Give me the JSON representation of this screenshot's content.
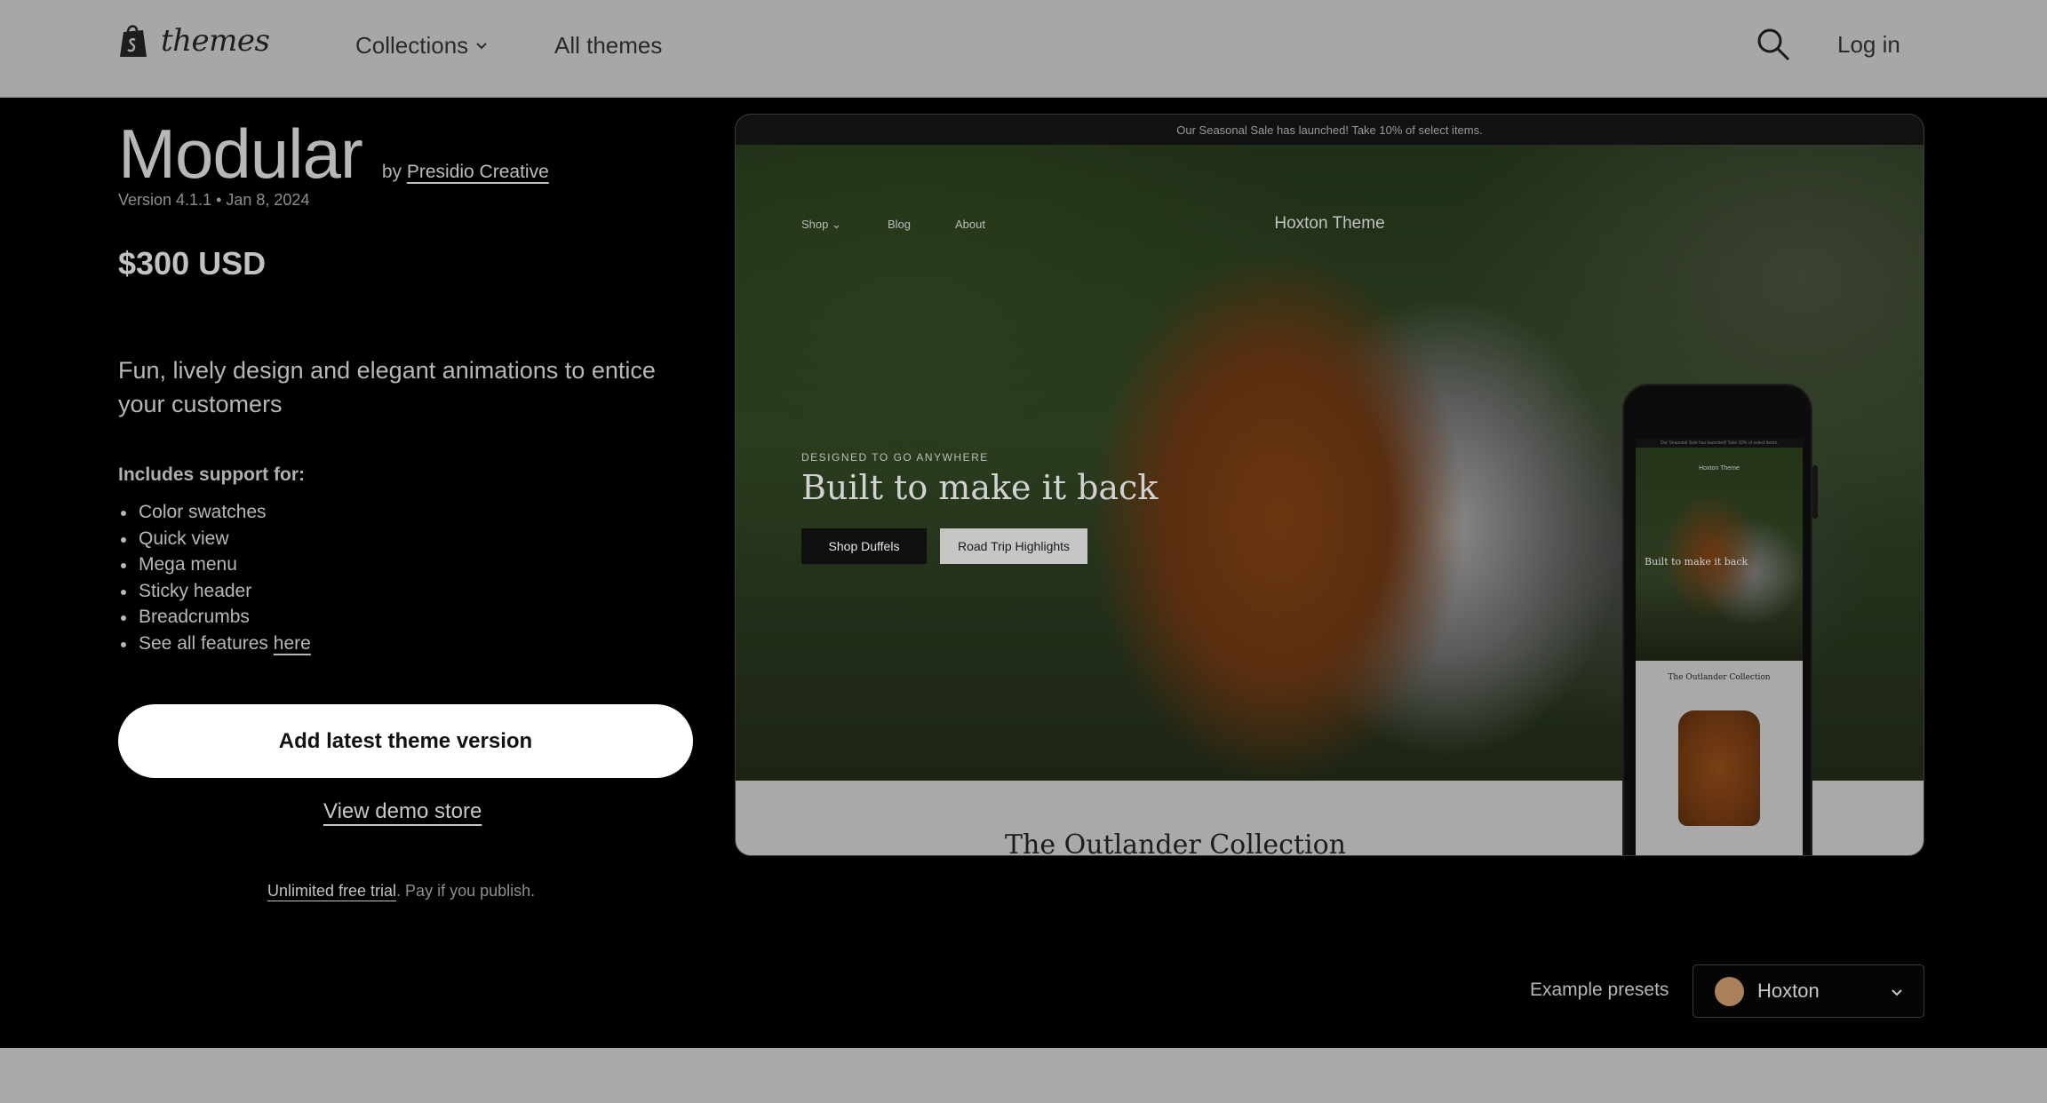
{
  "nav": {
    "logo_text": "themes",
    "collections": "Collections",
    "all_themes": "All themes",
    "login": "Log in"
  },
  "theme": {
    "title": "Modular",
    "by": "by",
    "author": "Presidio Creative",
    "version": "Version 4.1.1 • Jan 8, 2024",
    "price": "$300 USD",
    "description": "Fun, lively design and elegant animations to entice your customers",
    "support_title": "Includes support for:",
    "features": [
      "Color swatches",
      "Quick view",
      "Mega menu",
      "Sticky header",
      "Breadcrumbs"
    ],
    "features_last_prefix": "See all features ",
    "features_last_link": "here"
  },
  "actions": {
    "add_button": "Add latest theme version",
    "demo_link": "View demo store",
    "trial_link": "Unlimited free trial",
    "trial_suffix": ". Pay if you publish."
  },
  "preview": {
    "announcement": "Our Seasonal Sale has launched! Take 10% of select items.",
    "nav": {
      "shop": "Shop",
      "blog": "Blog",
      "about": "About"
    },
    "brand": "Hoxton Theme",
    "eyebrow": "DESIGNED TO GO ANYWHERE",
    "headline": "Built to make it back",
    "button_primary": "Shop Duffels",
    "button_secondary": "Road Trip Highlights",
    "collection_title": "The Outlander Collection",
    "icons": [
      "account-icon",
      "search-icon",
      "cart-icon"
    ]
  },
  "phone_preview": {
    "announcement": "Our Seasonal Sale has launched! Take 10% of select items.",
    "brand": "Hoxton Theme",
    "headline": "Built to make it back",
    "collection_title": "The Outlander Collection"
  },
  "presets": {
    "label": "Example presets",
    "selected": "Hoxton",
    "swatch_color": "#a9825b"
  },
  "colors": {
    "background": "#000000",
    "nav_bg": "#a7a7a7",
    "primary_button": "#ffffff"
  }
}
